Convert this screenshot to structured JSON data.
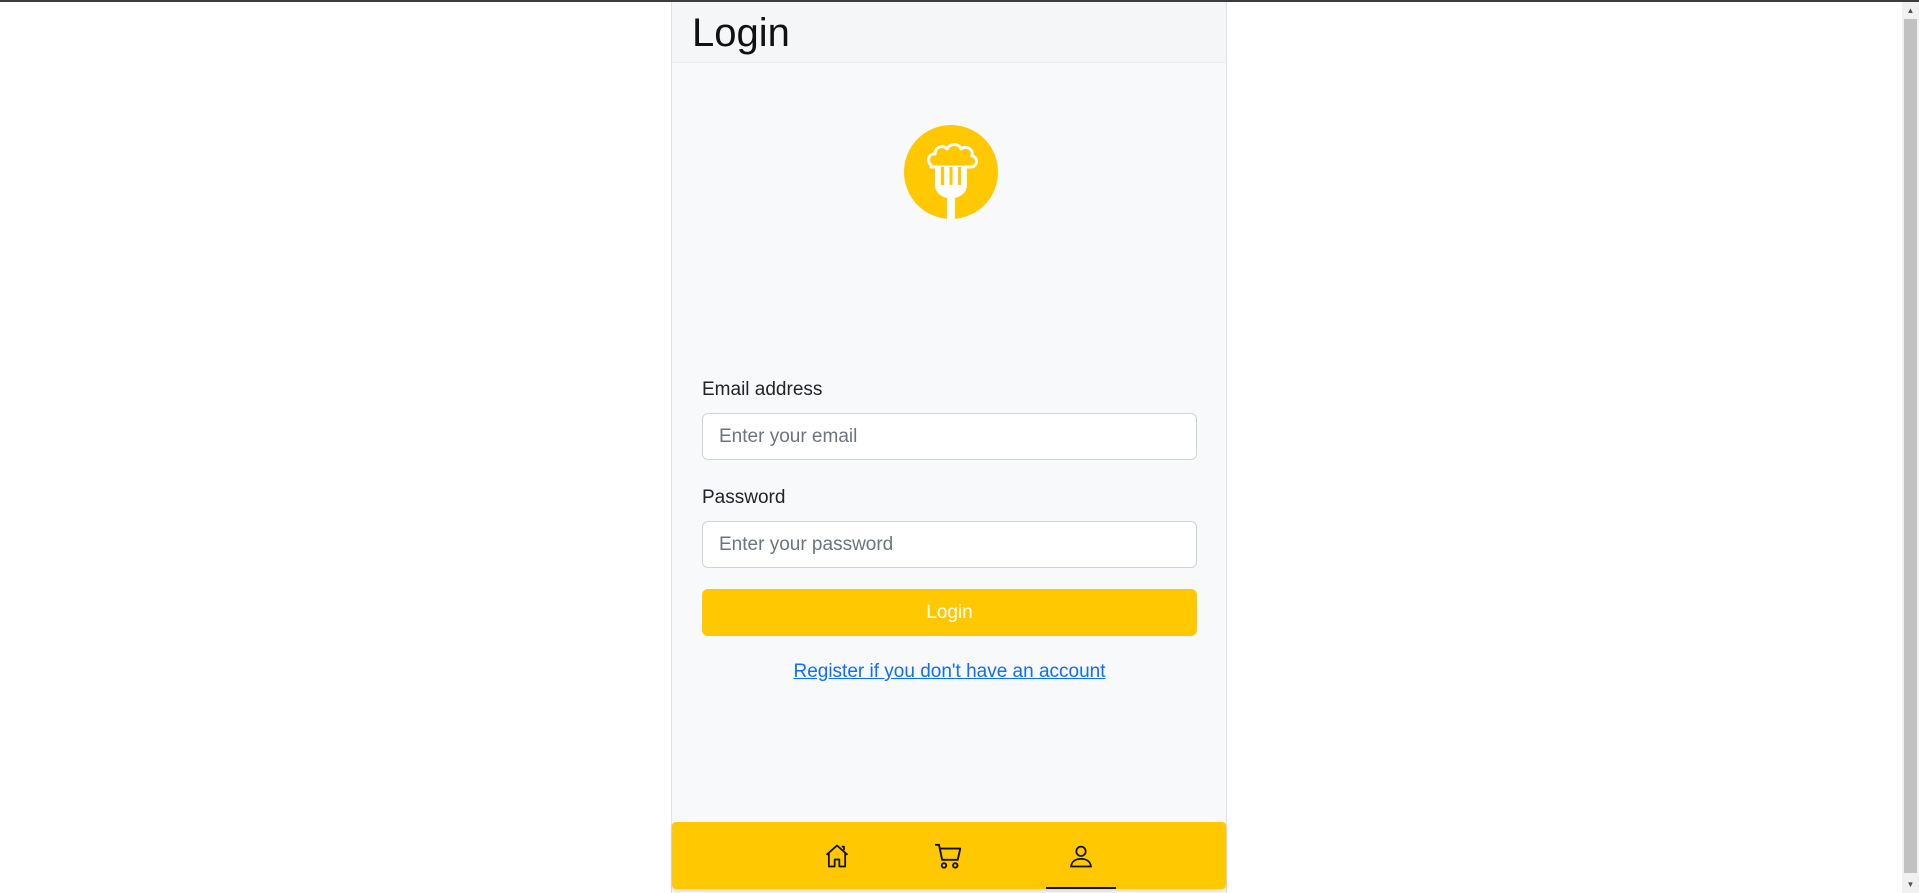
{
  "header": {
    "title": "Login"
  },
  "logo": {
    "icon": "fork-food-logo-icon",
    "color": "#ffc800"
  },
  "form": {
    "email_label": "Email address",
    "email_placeholder": "Enter your email",
    "email_value": "",
    "password_label": "Password",
    "password_placeholder": "Enter your password",
    "password_value": "",
    "submit_label": "Login",
    "register_link": "Register if you don't have an account"
  },
  "bottom_nav": {
    "items": [
      {
        "icon": "home-icon",
        "active": false
      },
      {
        "icon": "cart-icon",
        "active": false
      },
      {
        "icon": "user-icon",
        "active": true
      }
    ]
  },
  "colors": {
    "accent": "#ffc800",
    "link": "#0d6efd",
    "background": "#f8f9fa"
  }
}
